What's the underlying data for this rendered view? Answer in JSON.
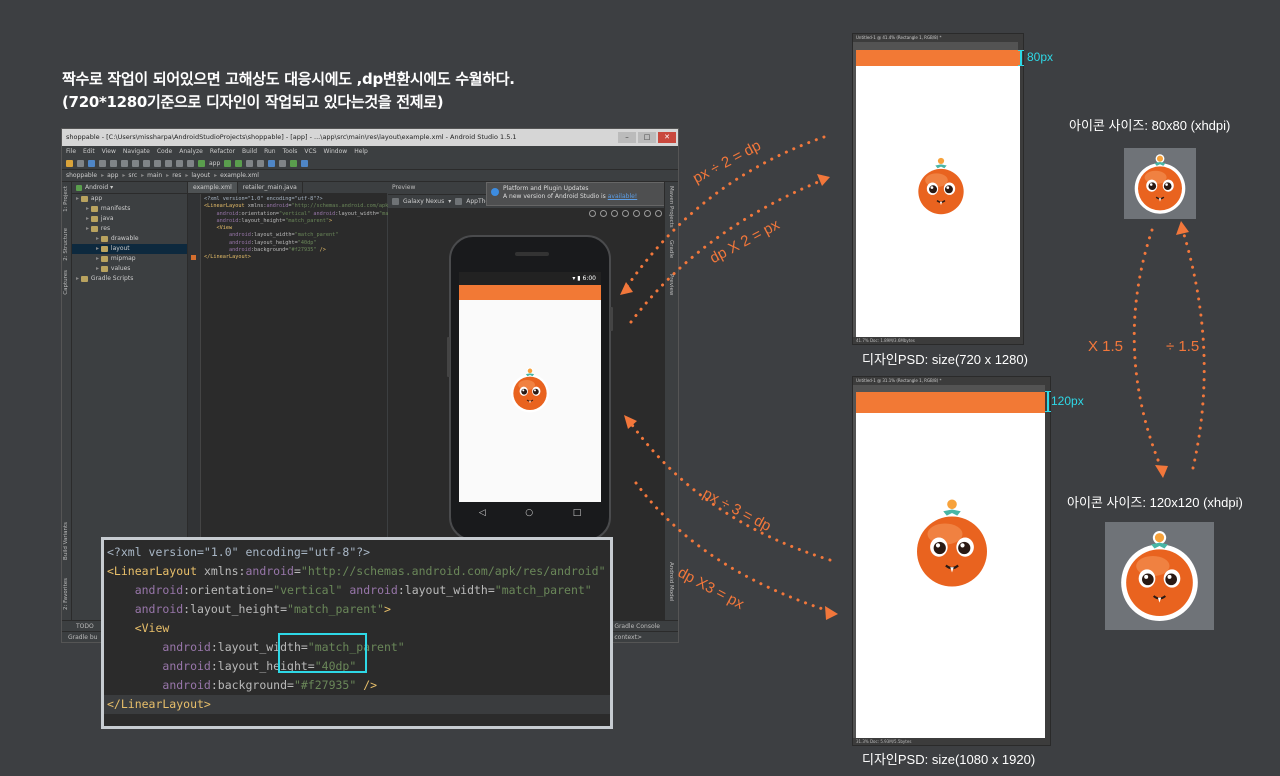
{
  "headline": {
    "line1": "짝수로 작업이 되어있으면 고해상도 대응시에도 ,dp변환시에도 수월하다.",
    "line2": "(720*1280기준으로 디자인이 작업되고 있다는것을 전제로)"
  },
  "ide": {
    "title": "shoppable - [C:\\Users\\missharpa\\AndroidStudioProjects\\shoppable] - [app] - ...\\app\\src\\main\\res\\layout\\example.xml - Android Studio 1.5.1",
    "menu": [
      "File",
      "Edit",
      "View",
      "Navigate",
      "Code",
      "Analyze",
      "Refactor",
      "Build",
      "Run",
      "Tools",
      "VCS",
      "Window",
      "Help"
    ],
    "toolbar_run_config": "app",
    "breadcrumbs": [
      "shoppable",
      "app",
      "src",
      "main",
      "res",
      "layout",
      "example.xml"
    ],
    "project_view": "Android",
    "tree": [
      {
        "label": "app",
        "indent": 0
      },
      {
        "label": "manifests",
        "indent": 1
      },
      {
        "label": "java",
        "indent": 1
      },
      {
        "label": "res",
        "indent": 1
      },
      {
        "label": "drawable",
        "indent": 2
      },
      {
        "label": "layout",
        "indent": 2,
        "selected": true
      },
      {
        "label": "mipmap",
        "indent": 2
      },
      {
        "label": "values",
        "indent": 2
      },
      {
        "label": "Gradle Scripts",
        "indent": 0
      }
    ],
    "tabs": [
      "example.xml",
      "retailer_main.java"
    ],
    "left_tool_labels": [
      "1: Project",
      "2: Structure",
      "Captures",
      "Build Variants",
      "2: Favorites"
    ],
    "right_tool_labels": [
      "Maven Projects",
      "Gradle",
      "Preview",
      "Android Model"
    ],
    "preview_label": "Preview",
    "preview_device": "Galaxy Nexus",
    "preview_theme": "AppTheme",
    "notification": {
      "title": "Platform and Plugin Updates",
      "body_prefix": "A new version of Android Studio is ",
      "body_link": "available!"
    },
    "bottom": {
      "tab_todo": "TODO",
      "gradle_console": "Gradle Console",
      "status_left": "Gradle bu",
      "status_right": "no context>"
    },
    "phone_time": "6:00",
    "nav_back": "◁",
    "nav_home": "○",
    "nav_recent": "□"
  },
  "code": {
    "decl": "<?xml version=\"1.0\" encoding=\"utf-8\"?>",
    "ll_open_tag": "<LinearLayout",
    "xmlns_attr": " xmlns:",
    "xmlns_ns": "android",
    "xmlns_eq": "=",
    "xmlns_val": "\"http://schemas.android.com/apk/res/android\"",
    "ns": "android",
    "orientation_attr": ":orientation=",
    "orientation_val": "\"vertical\"",
    "lw_attr": ":layout_width=",
    "lw_val": "\"match_parent\"",
    "lh_attr": ":layout_height=",
    "lh_val": "\"match_parent\"",
    "ll_gt": ">",
    "view_tag": "<View",
    "v_lw_attr": ":layout_width=",
    "v_lw_val": "\"match_parent\"",
    "v_lh_attr": ":layout_height=",
    "v_lh_val": "\"40dp\"",
    "v_bg_attr": ":background=",
    "v_bg_val": "\"#f27935\"",
    "v_close": " />",
    "ll_close": "</LinearLayout>"
  },
  "psd_top": {
    "title": "Untitled-1 @ 41.4% (Rectangle 1, RGB/8) *",
    "status": "41.7%     Doc: 1.89M/3.6Mbytes",
    "bar_label": "80px",
    "caption": "디자인PSD: size(720 x 1280)"
  },
  "psd_bottom": {
    "title": "Untitled-1 @ 31.1% (Rectangle 1, RGB/8) *",
    "status": "31.3%     Doc: 5.93M/5.5bytes",
    "bar_label": "120px",
    "caption": "디자인PSD: size(1080 x 1920)"
  },
  "icons": {
    "top_label": "아이콘 사이즈: 80x80 (xhdpi)",
    "bottom_label": "아이콘 사이즈: 120x120 (xhdpi)"
  },
  "arrows": {
    "px_div2": "px ÷ 2 = dp",
    "dp_x2": "dp X 2 = px",
    "px_div3": "px ÷ 3 = dp",
    "dp_x3": "dp X3 = px",
    "x15": "X 1.5",
    "div15": "÷ 1.5"
  },
  "colors": {
    "accent_orange": "#f27935",
    "highlight_cyan": "#2ed8e6",
    "arrow_orange": "#f2773b"
  }
}
